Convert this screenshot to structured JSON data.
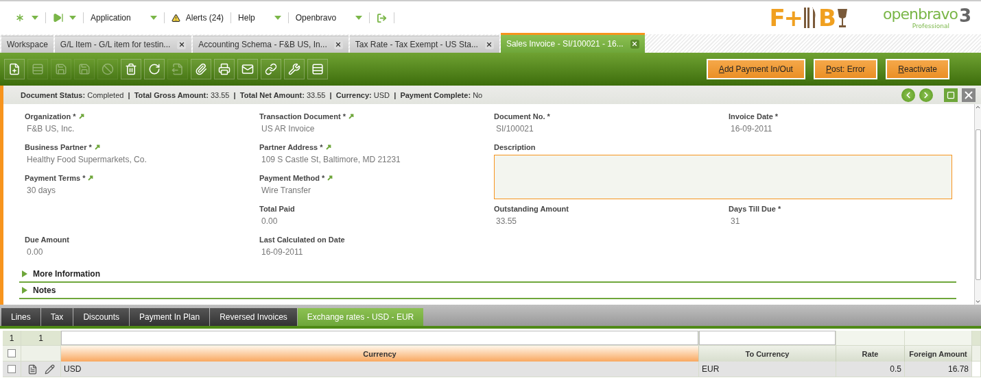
{
  "menu": [
    {
      "kind": "quick-launch"
    },
    {
      "kind": "recent"
    },
    {
      "kind": "menu",
      "label": "Application"
    },
    {
      "kind": "alerts",
      "label": "Alerts (24)"
    },
    {
      "kind": "menu",
      "label": "Help"
    },
    {
      "kind": "menu",
      "label": "Openbravo"
    },
    {
      "kind": "logout"
    }
  ],
  "fb_logo": {
    "left": "F+",
    "right": "B"
  },
  "openbravo_logo": {
    "name": "openbravo",
    "edition": "Professional",
    "version": "3"
  },
  "tabs": [
    {
      "label": "Workspace",
      "closable": false,
      "selected": false
    },
    {
      "label": "G/L Item - G/L item for testin...",
      "closable": true,
      "selected": false
    },
    {
      "label": "Accounting Schema - F&B US, In...",
      "closable": true,
      "selected": false
    },
    {
      "label": "Tax Rate - Tax Exempt - US Sta...",
      "closable": true,
      "selected": false
    },
    {
      "label": "Sales Invoice - SI/100021 - 16...",
      "closable": true,
      "selected": true
    }
  ],
  "toolbar": [
    {
      "kind": "new",
      "disabled": false
    },
    {
      "kind": "grid-new",
      "disabled": true
    },
    {
      "kind": "save",
      "disabled": true
    },
    {
      "kind": "save-close",
      "disabled": true
    },
    {
      "kind": "undo",
      "disabled": true
    },
    {
      "kind": "delete",
      "disabled": false
    },
    {
      "kind": "refresh",
      "disabled": false
    },
    {
      "kind": "export",
      "disabled": true
    },
    {
      "kind": "attach",
      "disabled": false
    },
    {
      "kind": "print",
      "disabled": false
    },
    {
      "kind": "email",
      "disabled": false
    },
    {
      "kind": "link",
      "disabled": false
    },
    {
      "kind": "tools",
      "disabled": false
    },
    {
      "kind": "layout",
      "disabled": false
    }
  ],
  "actions": [
    {
      "label": "Add Payment In/Out"
    },
    {
      "label": "Post: Error"
    },
    {
      "label": "Reactivate"
    }
  ],
  "status_bar": "**Document Status:** Completed  **|**  **Total Gross Amount:** 33.55  **|**  **Total Net Amount:** 33.55  **|**  **Currency:** USD  **|**  **Payment Complete:** No",
  "fields": [
    {
      "label": "Organization *",
      "value": "F&B US, Inc.",
      "link": true,
      "kind": "text"
    },
    {
      "label": "Transaction Document *",
      "value": "US AR Invoice",
      "link": true,
      "kind": "text"
    },
    {
      "label": "Document No. *",
      "value": "SI/100021",
      "link": false,
      "kind": "text"
    },
    {
      "label": "Invoice Date *",
      "value": "16-09-2011",
      "link": false,
      "kind": "text"
    },
    {
      "label": "Business Partner *",
      "value": "Healthy Food Supermarkets, Co.",
      "link": true,
      "kind": "text"
    },
    {
      "label": "Partner Address *",
      "value": "109 S Castle St, Baltimore, MD 21231",
      "link": true,
      "kind": "text"
    },
    {
      "label": "Description",
      "link": false,
      "kind": "textarea"
    },
    {
      "label": "Payment Terms *",
      "value": "30 days",
      "link": true,
      "kind": "text"
    },
    {
      "label": "Payment Method *",
      "value": "Wire Transfer",
      "link": true,
      "kind": "text"
    },
    {
      "label": "Total Paid",
      "value": "0.00",
      "link": false,
      "kind": "text"
    },
    {
      "label": "Outstanding Amount",
      "value": "33.55",
      "link": false,
      "kind": "text"
    },
    {
      "label": "Days Till Due *",
      "value": "31",
      "link": false,
      "kind": "text"
    },
    {
      "label": "Due Amount",
      "value": "0.00",
      "link": false,
      "kind": "text"
    },
    {
      "label": "Last Calculated on Date",
      "value": "16-09-2011",
      "link": false,
      "kind": "text"
    }
  ],
  "sections": [
    {
      "label": "More Information",
      "expanded": false
    },
    {
      "label": "Notes",
      "expanded": false
    }
  ],
  "subtabs": [
    {
      "label": "Lines",
      "selected": false
    },
    {
      "label": "Tax",
      "selected": false
    },
    {
      "label": "Discounts",
      "selected": false
    },
    {
      "label": "Payment In Plan",
      "selected": false
    },
    {
      "label": "Reversed Invoices",
      "selected": false
    },
    {
      "label": "Exchange rates - USD - EUR",
      "selected": true
    }
  ],
  "grid": {
    "row_count": "1",
    "selected_count": "1",
    "all_checked": false,
    "columns": [
      {
        "label": "Currency",
        "sorted": true
      },
      {
        "label": "To Currency",
        "sorted": false
      },
      {
        "label": "Rate",
        "sorted": false
      },
      {
        "label": "Foreign Amount",
        "sorted": false
      }
    ],
    "rows": [
      {
        "checked": false,
        "cells": [
          "USD",
          "EUR",
          "0.5",
          "16.78"
        ]
      }
    ]
  }
}
